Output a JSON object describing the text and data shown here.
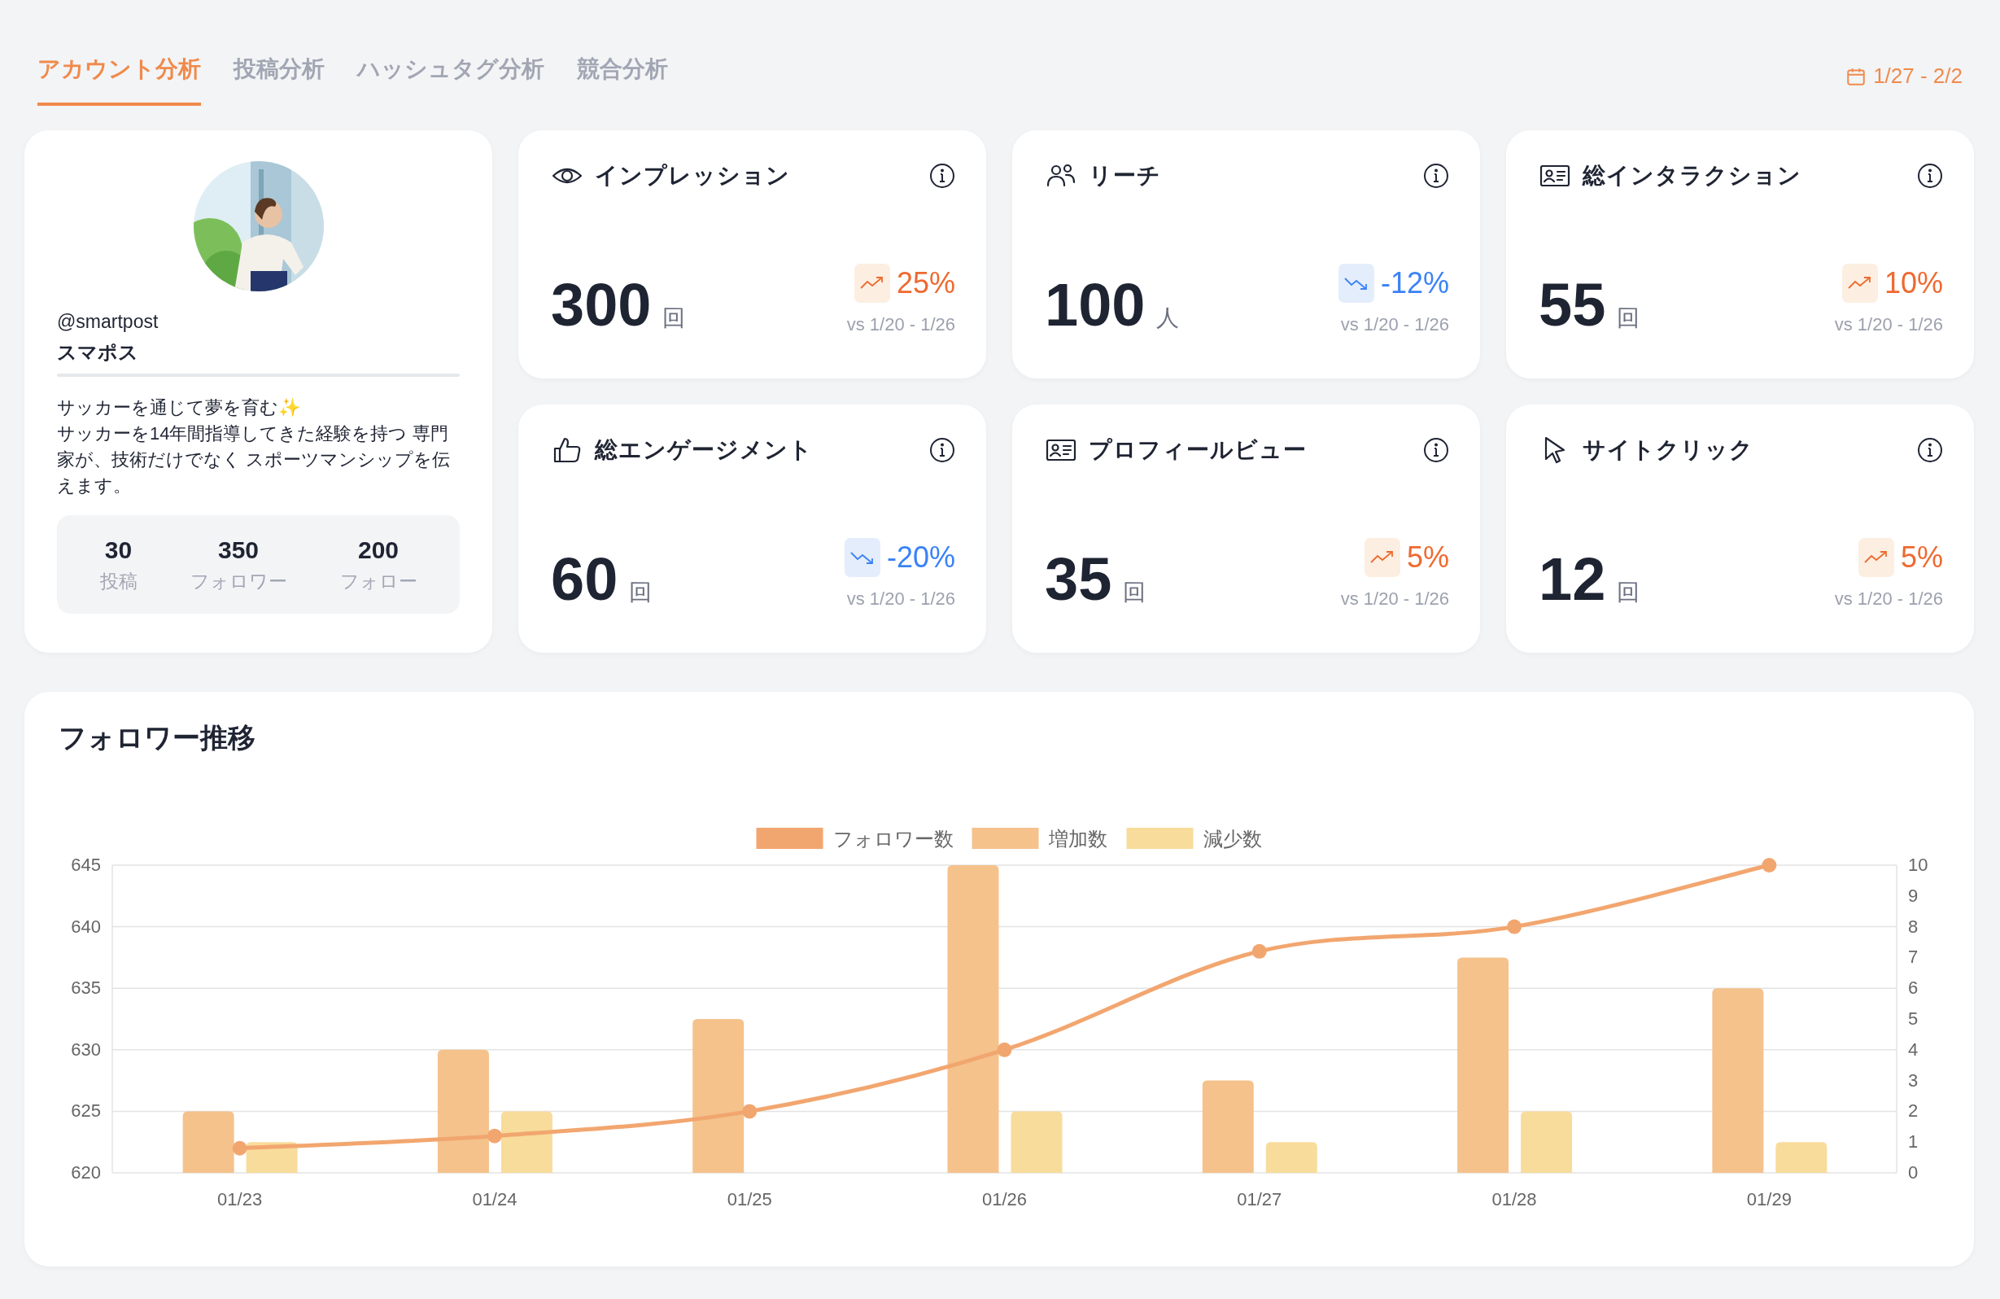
{
  "tabs": [
    {
      "label": "アカウント分析",
      "selected": true
    },
    {
      "label": "投稿分析",
      "selected": false
    },
    {
      "label": "ハッシュタグ分析",
      "selected": false
    },
    {
      "label": "競合分析",
      "selected": false
    }
  ],
  "date_range": "1/27 - 2/2",
  "profile": {
    "handle": "@smartpost",
    "name": "スマポス",
    "bio": "サッカーを通じて夢を育む✨\nサッカーを14年間指導してきた経験を持つ 専門家が、技術だけでなく スポーツマンシップを伝えます。",
    "stats": [
      {
        "value": "30",
        "label": "投稿"
      },
      {
        "value": "350",
        "label": "フォロワー"
      },
      {
        "value": "200",
        "label": "フォロー"
      }
    ]
  },
  "metrics": [
    {
      "title": "インプレッション",
      "value": "300",
      "unit": "回",
      "kind": "up",
      "change": "25%",
      "compare": "vs 1/20 - 1/26"
    },
    {
      "title": "リーチ",
      "value": "100",
      "unit": "人",
      "kind": "down",
      "change": "-12%",
      "compare": "vs 1/20 - 1/26"
    },
    {
      "title": "総インタラクション",
      "value": "55",
      "unit": "回",
      "kind": "up",
      "change": "10%",
      "compare": "vs 1/20 - 1/26"
    },
    {
      "title": "総エンゲージメント",
      "value": "60",
      "unit": "回",
      "kind": "down",
      "change": "-20%",
      "compare": "vs 1/20 - 1/26"
    },
    {
      "title": "プロフィールビュー",
      "value": "35",
      "unit": "回",
      "kind": "up",
      "change": "5%",
      "compare": "vs 1/20 - 1/26"
    },
    {
      "title": "サイトクリック",
      "value": "12",
      "unit": "回",
      "kind": "up",
      "change": "5%",
      "compare": "vs 1/20 - 1/26"
    }
  ],
  "follower_chart": {
    "title": "フォロワー推移",
    "chart_data": {
      "type": "bar",
      "categories": [
        "01/23",
        "01/24",
        "01/25",
        "01/26",
        "01/27",
        "01/28",
        "01/29"
      ],
      "series": [
        {
          "name": "フォロワー数",
          "color": "#f2a66f",
          "type": "line",
          "marker": true,
          "values": [
            622,
            623,
            625,
            630,
            638,
            640,
            645
          ]
        },
        {
          "name": "増加数",
          "color": "#f5c28c",
          "type": "bar",
          "axis": "y2",
          "values": [
            2,
            4,
            5,
            10,
            3,
            7,
            6
          ]
        },
        {
          "name": "減少数",
          "color": "#f8dc9b",
          "type": "bar",
          "axis": "y2",
          "values": [
            1,
            2,
            0,
            2,
            1,
            2,
            1
          ]
        }
      ],
      "grid": true,
      "legend": "top",
      "ylim": [
        620,
        645
      ],
      "yticks": [
        620,
        625,
        630,
        635,
        640,
        645
      ],
      "y2lim": [
        0,
        10
      ],
      "y2ticks": [
        0,
        1,
        2,
        3,
        4,
        5,
        6,
        7,
        8,
        9,
        10
      ]
    }
  }
}
